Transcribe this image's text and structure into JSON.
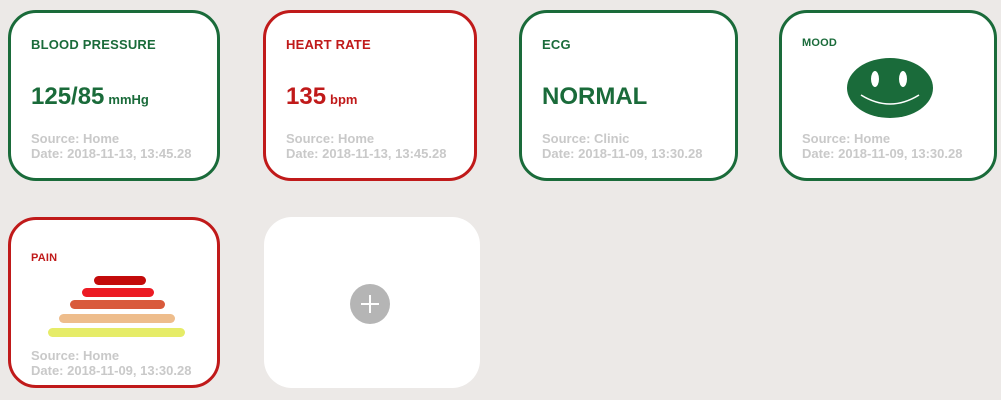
{
  "cards": {
    "blood_pressure": {
      "title": "BLOOD PRESSURE",
      "value": "125/85",
      "unit": "mmHg",
      "source": "Source: Home",
      "date": "Date: 2018-11-13, 13:45.28",
      "border_color": "#1a6b3a"
    },
    "heart_rate": {
      "title": "HEART RATE",
      "value": "135",
      "unit": "bpm",
      "source": "Source: Home",
      "date": "Date: 2018-11-13, 13:45.28",
      "border_color": "#c01a1a"
    },
    "ecg": {
      "title": "ECG",
      "value": "NORMAL",
      "source": "Source: Clinic",
      "date": "Date: 2018-11-09, 13:30.28",
      "border_color": "#1a6b3a"
    },
    "mood": {
      "title": "MOOD",
      "icon": "smiley-face-icon",
      "icon_color": "#1a6b3a",
      "source": "Source: Home",
      "date": "Date: 2018-11-09, 13:30.28",
      "border_color": "#1a6b3a"
    },
    "pain": {
      "title": "PAIN",
      "icon": "pain-scale-pyramid-icon",
      "scale_colors": [
        "#c30a0a",
        "#ec1b24",
        "#d95a3b",
        "#eebd8c",
        "#e6ec68"
      ],
      "source": "Source: Home",
      "date": "Date: 2018-11-09, 13:30.28",
      "border_color": "#c01a1a"
    },
    "add": {
      "icon": "plus-icon"
    }
  },
  "colors": {
    "background": "#ece9e7",
    "accent_green": "#1a6b3a",
    "accent_red": "#c01a1a",
    "meta_text": "#c9c9c9"
  }
}
